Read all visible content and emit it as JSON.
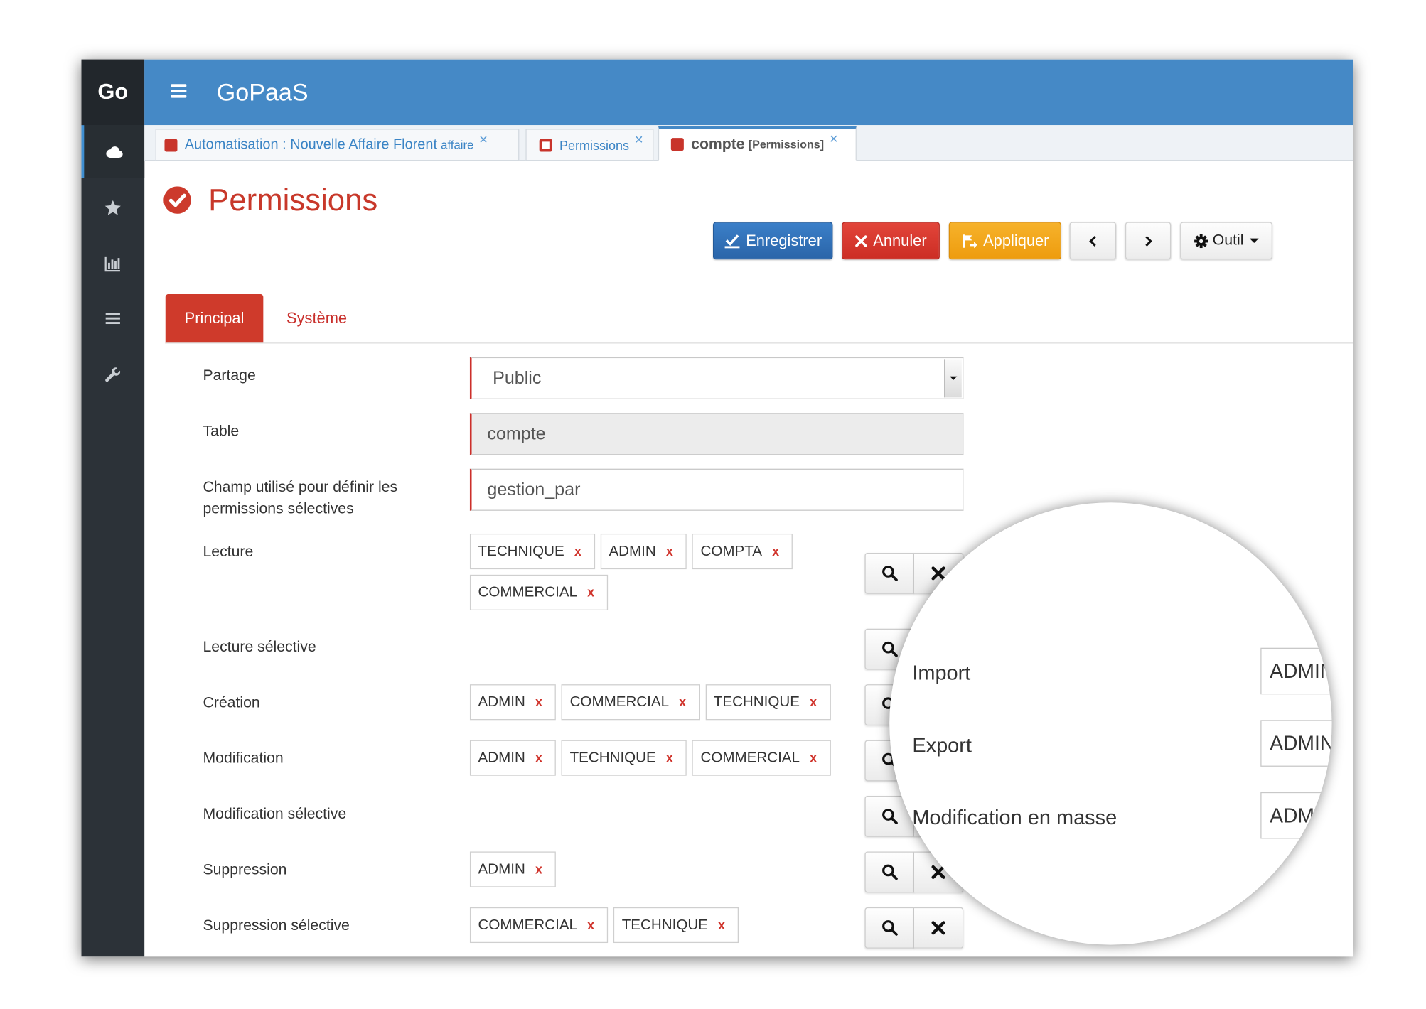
{
  "app": {
    "logo": "Go",
    "title": "GoPaaS"
  },
  "sidebar": {
    "items": [
      {
        "icon": "cloud-icon",
        "active": true
      },
      {
        "icon": "star-icon"
      },
      {
        "icon": "bar-chart-icon"
      },
      {
        "icon": "list-icon"
      },
      {
        "icon": "wrench-icon"
      }
    ]
  },
  "window_tabs": [
    {
      "icon": "filled-square-icon",
      "label": "Automatisation : Nouvelle Affaire Florent",
      "sub": "affaire",
      "close": "×"
    },
    {
      "icon": "outline-square-icon",
      "label": "Permissions",
      "close": "×"
    },
    {
      "icon": "filled-square-icon",
      "label": "compte",
      "sub": "[Permissions]",
      "close": "×",
      "active": true
    }
  ],
  "page": {
    "title": "Permissions",
    "icon": "check-circle-icon"
  },
  "toolbar": {
    "save": "Enregistrer",
    "cancel": "Annuler",
    "apply": "Appliquer",
    "tools": "Outil",
    "prev_icon": "chevron-left-icon",
    "next_icon": "chevron-right-icon"
  },
  "form_tabs": [
    {
      "label": "Principal",
      "active": true
    },
    {
      "label": "Système"
    }
  ],
  "form": {
    "sharing": {
      "label": "Partage",
      "value": "Public"
    },
    "table": {
      "label": "Table",
      "value": "compte"
    },
    "field": {
      "label": "Champ utilisé pour définir les permissions sélectives",
      "value": "gestion_par"
    },
    "tag_remove": "x",
    "permissions": [
      {
        "label": "Lecture",
        "tags": [
          "TECHNIQUE",
          "ADMIN",
          "COMPTA",
          "COMMERCIAL"
        ]
      },
      {
        "label": "Lecture sélective",
        "tags": []
      },
      {
        "label": "Création",
        "tags": [
          "ADMIN",
          "COMMERCIAL",
          "TECHNIQUE"
        ]
      },
      {
        "label": "Modification",
        "tags": [
          "ADMIN",
          "TECHNIQUE",
          "COMMERCIAL"
        ]
      },
      {
        "label": "Modification sélective",
        "tags": []
      },
      {
        "label": "Suppression",
        "tags": [
          "ADMIN"
        ]
      },
      {
        "label": "Suppression sélective",
        "tags": [
          "COMMERCIAL",
          "TECHNIQUE"
        ]
      }
    ]
  },
  "magnifier": {
    "rows": [
      {
        "label": "Import",
        "value": "ADMIN"
      },
      {
        "label": "Export",
        "value": "ADMIN"
      },
      {
        "label": "Modification en masse",
        "value": "ADMIN"
      }
    ]
  },
  "colors": {
    "header": "#4589c6",
    "sidebar": "#2c3238",
    "title_red": "#c8382a",
    "save": "#2e6fb7",
    "cancel": "#d9342b",
    "apply": "#f0a30a",
    "active_form_tab": "#cf3a2b"
  }
}
